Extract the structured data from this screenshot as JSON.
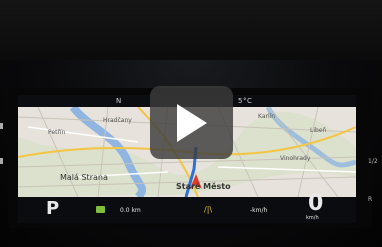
{
  "cluster": {
    "heading": "N",
    "temperature": "5°C"
  },
  "map": {
    "labels": [
      {
        "text": "Malá Strana"
      },
      {
        "text": "Staré Město"
      },
      {
        "text": "Petřín"
      },
      {
        "text": "Hradčany"
      },
      {
        "text": "Karlín"
      },
      {
        "text": "Libeň"
      },
      {
        "text": "Vinohrady"
      }
    ]
  },
  "bottom_bar": {
    "gear": "P",
    "trip": "0.0 km",
    "speed_unit_small": "-km/h",
    "speed": "0",
    "speed_unit": "km/h"
  },
  "side_right": [
    "1/2",
    "R"
  ],
  "colors": {
    "accent_yellow": "#e6c21c",
    "route_blue": "#2f6fd8",
    "warn_green": "#7fbf3a",
    "arrow_red": "#e23a2e"
  }
}
